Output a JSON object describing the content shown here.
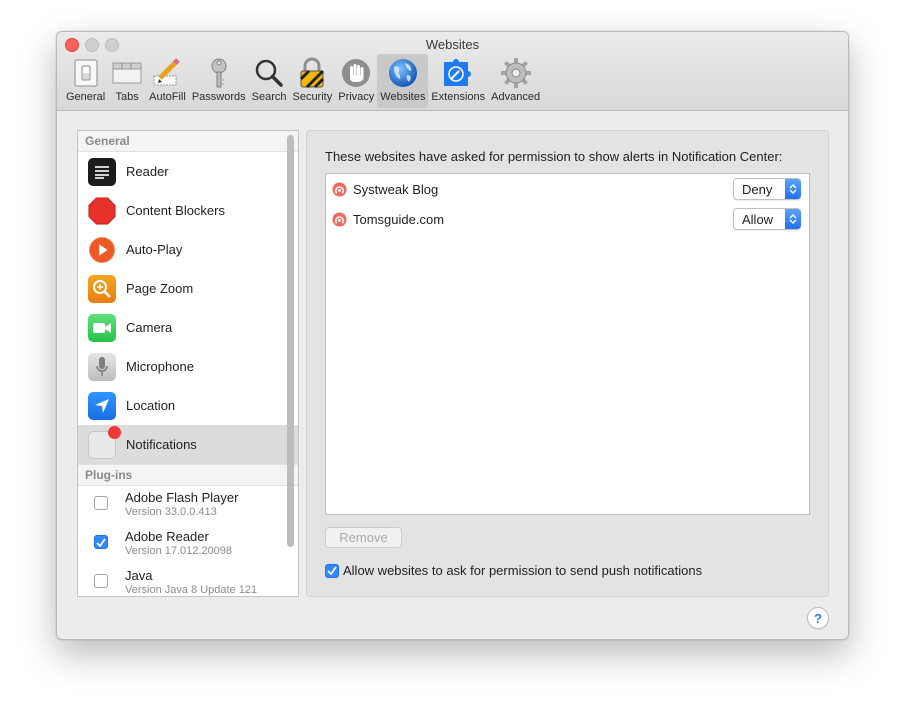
{
  "window": {
    "title": "Websites"
  },
  "toolbar": {
    "items": [
      {
        "label": "General",
        "icon": "switch-icon"
      },
      {
        "label": "Tabs",
        "icon": "tabs-icon"
      },
      {
        "label": "AutoFill",
        "icon": "pencil-icon"
      },
      {
        "label": "Passwords",
        "icon": "key-icon"
      },
      {
        "label": "Search",
        "icon": "magnifier-icon"
      },
      {
        "label": "Security",
        "icon": "padlock-icon"
      },
      {
        "label": "Privacy",
        "icon": "hand-icon"
      },
      {
        "label": "Websites",
        "icon": "globe-icon",
        "selected": true
      },
      {
        "label": "Extensions",
        "icon": "puzzle-icon"
      },
      {
        "label": "Advanced",
        "icon": "gear-icon"
      }
    ]
  },
  "sidebar": {
    "general_header": "General",
    "items": [
      {
        "label": "Reader",
        "icon": "reader-icon"
      },
      {
        "label": "Content Blockers",
        "icon": "stop-sign-icon"
      },
      {
        "label": "Auto-Play",
        "icon": "play-icon"
      },
      {
        "label": "Page Zoom",
        "icon": "zoom-icon"
      },
      {
        "label": "Camera",
        "icon": "camera-icon"
      },
      {
        "label": "Microphone",
        "icon": "microphone-icon"
      },
      {
        "label": "Location",
        "icon": "location-arrow-icon"
      },
      {
        "label": "Notifications",
        "icon": "notification-icon",
        "selected": true
      }
    ],
    "plugins_header": "Plug-ins",
    "plugins": [
      {
        "name": "Adobe Flash Player",
        "version": "Version 33.0.0.413",
        "enabled": false
      },
      {
        "name": "Adobe Reader",
        "version": "Version 17.012.20098",
        "enabled": true
      },
      {
        "name": "Java",
        "version": "Version Java 8 Update 121",
        "enabled": false
      }
    ]
  },
  "panel": {
    "description": "These websites have asked for permission to show alerts in Notification Center:",
    "sites": [
      {
        "name": "Systweak Blog",
        "permission": "Deny"
      },
      {
        "name": "Tomsguide.com",
        "permission": "Allow"
      }
    ],
    "remove_label": "Remove",
    "allow_push_label": "Allow websites to ask for permission to send push notifications",
    "allow_push_checked": true
  },
  "help": {
    "label": "?"
  },
  "colors": {
    "accent": "#2f8aff",
    "close": "#fc605c",
    "selection": "#dcdcdc"
  }
}
